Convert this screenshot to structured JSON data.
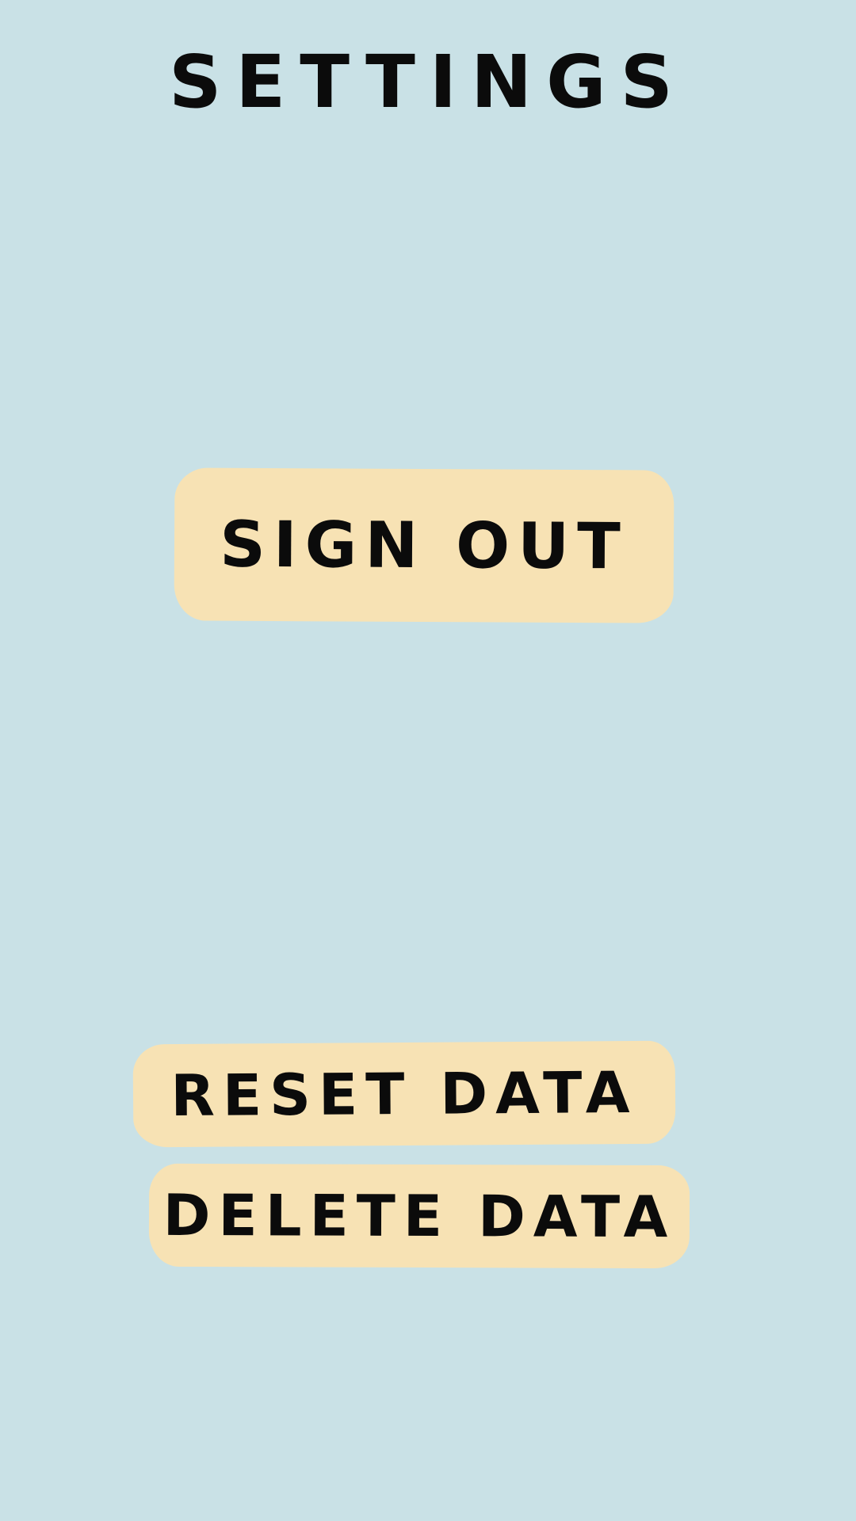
{
  "header": {
    "title": "SETTINGS"
  },
  "actions": {
    "sign_out_label": "SIGN OUT",
    "reset_data_label": "RESET DATA",
    "delete_data_label": "DELETE DATA"
  },
  "colors": {
    "background": "#c9e1e6",
    "button_fill": "#f7e2b4",
    "text": "#0b0b0b"
  }
}
